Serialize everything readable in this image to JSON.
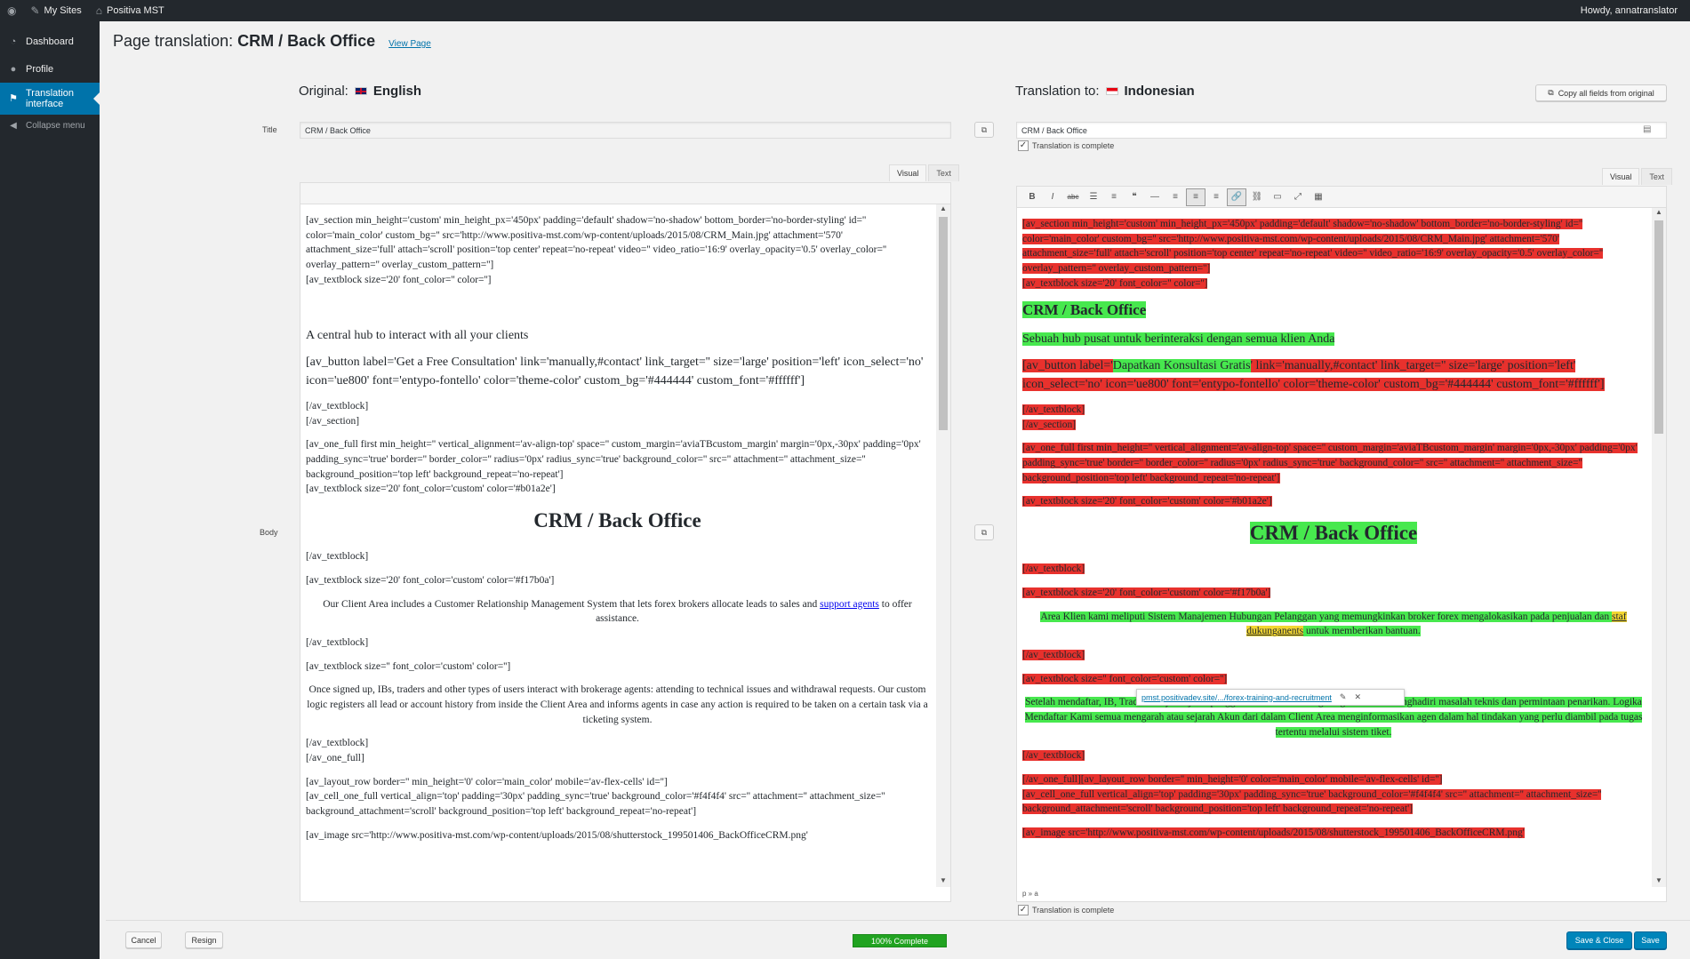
{
  "adminbar": {
    "mysites": "My Sites",
    "site": "Positiva MST",
    "howdy": "Howdy, annatranslator"
  },
  "sidebar": {
    "items": [
      {
        "label": "Dashboard",
        "icon": "dashboard-icon"
      },
      {
        "label": "Profile",
        "icon": "user-icon"
      },
      {
        "label": "Translation interface",
        "icon": "translation-icon"
      }
    ],
    "collapse": "Collapse menu"
  },
  "header": {
    "prefix": "Page translation:",
    "title": "CRM / Back Office",
    "view_link": "View Page"
  },
  "original": {
    "label": "Original:",
    "lang": "English"
  },
  "translation": {
    "label": "Translation to:",
    "lang": "Indonesian",
    "copy_all": "Copy all fields from original"
  },
  "fields": {
    "title_label": "Title",
    "body_label": "Body",
    "title_original": "CRM / Back Office",
    "title_translation": "CRM / Back Office",
    "complete_label": "Translation is complete"
  },
  "tabs": {
    "visual": "Visual",
    "text": "Text"
  },
  "original_body": {
    "p1": "[av_section min_height='custom' min_height_px='450px' padding='default' shadow='no-shadow' bottom_border='no-border-styling' id='' color='main_color' custom_bg='' src='http://www.positiva-mst.com/wp-content/uploads/2015/08/CRM_Main.jpg' attachment='570' attachment_size='full' attach='scroll' position='top center' repeat='no-repeat' video='' video_ratio='16:9' overlay_opacity='0.5' overlay_color='' overlay_pattern='' overlay_custom_pattern='']",
    "p1b": "[av_textblock size='20' font_color='' color='']",
    "h_ghost": "CRM / Back Office",
    "tagline": "A central hub to interact with all your clients",
    "button": "[av_button label='Get a Free Consultation' link='manually,#contact' link_target='' size='large' position='left' icon_select='no' icon='ue800' font='entypo-fontello' color='theme-color' custom_bg='#444444' custom_font='#ffffff']",
    "p2a": "[/av_textblock]",
    "p2b": "[/av_section]",
    "p3": "[av_one_full first min_height='' vertical_alignment='av-align-top' space='' custom_margin='aviaTBcustom_margin' margin='0px,-30px' padding='0px' padding_sync='true' border='' border_color='' radius='0px' radius_sync='true' background_color='' src='' attachment='' attachment_size='' background_position='top left' background_repeat='no-repeat']",
    "p3b": "[av_textblock size='20' font_color='custom' color='#b01a2e']",
    "h1": "CRM / Back Office",
    "p4": "[/av_textblock]",
    "p5": "[av_textblock size='20' font_color='custom' color='#f17b0a']",
    "p6a": "Our Client Area includes a Customer Relationship Management System that lets forex brokers allocate leads to sales and",
    "p6link": "support agents",
    "p6b": "to offer assistance.",
    "p7": "[/av_textblock]",
    "p8": "[av_textblock size='' font_color='custom' color='']",
    "p9": "Once signed up, IBs, traders and other types of users interact with brokerage agents: attending to technical issues and withdrawal requests. Our custom logic registers all lead or account history from inside the Client Area and informs agents in case any action is required to be taken on a certain task via a ticketing system.",
    "p10a": "[/av_textblock]",
    "p10b": "[/av_one_full]",
    "p11": "[av_layout_row border='' min_height='0' color='main_color' mobile='av-flex-cells' id='']",
    "p11b": "[av_cell_one_full vertical_align='top' padding='30px' padding_sync='true' background_color='#f4f4f4' src='' attachment='' attachment_size='' background_attachment='scroll' background_position='top left' background_repeat='no-repeat']",
    "p12": "[av_image src='http://www.positiva-mst.com/wp-content/uploads/2015/08/shutterstock_199501406_BackOfficeCRM.png'"
  },
  "translation_body": {
    "p1": "[av_section min_height='custom' min_height_px='450px' padding='default' shadow='no-shadow' bottom_border='no-border-styling' id='' color='main_color' custom_bg='' src='http://www.positiva-mst.com/wp-content/uploads/2015/08/CRM_Main.jpg' attachment='570' attachment_size='full' attach='scroll' position='top center' repeat='no-repeat' video='' video_ratio='16:9' overlay_opacity='0.5' overlay_color='' overlay_pattern='' overlay_custom_pattern='']",
    "p1b": "[av_textblock size='20' font_color='' color='']",
    "h2": "CRM / Back Office",
    "tagline": "Sebuah hub pusat untuk berinteraksi dengan semua klien Anda",
    "btn_a": "[av_button label='",
    "btn_label": "Dapatkan Konsultasi Gratis",
    "btn_b": "' link='manually,#contact' link_target='' size='large' position='left' icon_select='no' icon='ue800' font='entypo-fontello' color='theme-color' custom_bg='#444444' custom_font='#ffffff']",
    "p2a": "[/av_textblock]",
    "p2b": "[/av_section]",
    "p3": "[av_one_full first min_height='' vertical_alignment='av-align-top' space='' custom_margin='aviaTBcustom_margin' margin='0px,-30px' padding='0px' padding_sync='true' border='' border_color='' radius='0px' radius_sync='true' background_color='' src='' attachment='' attachment_size='' background_position='top left' background_repeat='no-repeat']",
    "p3b": "[av_textblock size='20' font_color='custom' color='#b01a2e']",
    "h1": "CRM / Back Office",
    "p4": "[/av_textblock]",
    "p5": "[av_textblock size='20' font_color='custom' color='#f17b0a']",
    "p6a": "Area Klien kami meliputi Sistem Manajemen Hubungan Pelanggan yang memungkinkan broker forex mengalokasikan pada penjualan dan",
    "p6link": "staf dukunganents",
    "p6b": "untuk memberikan bantuan.",
    "p7": "[/av_textblock]",
    "p8": "[av_textblock size='' font_color='custom' color='']",
    "p9": "Setelah mendaftar, IB, Trader dan jenis-jenis pengguna berinteraksi dengan agen broker: menghadiri masalah teknis dan permintaan penarikan. Logika Mendaftar Kami semua mengarah atau sejarah Akun dari dalam Client Area menginformasikan agen dalam hal tindakan yang perlu diambil pada tugas tertentu melalui sistem tiket.",
    "p10": "[/av_textblock]",
    "p11": "[/av_one_full][av_layout_row border='' min_height='0' color='main_color' mobile='av-flex-cells' id='']",
    "p11b": "[av_cell_one_full vertical_align='top' padding='30px' padding_sync='true' background_color='#f4f4f4' src='' attachment='' attachment_size='' background_attachment='scroll' background_position='top left' background_repeat='no-repeat']",
    "p12": "[av_image src='http://www.positiva-mst.com/wp-content/uploads/2015/08/shutterstock_199501406_BackOfficeCRM.png'",
    "path": "p » a"
  },
  "link_popup": {
    "url": "pmst.positivadev.site/.../forex-training-and-recruitment"
  },
  "footer": {
    "cancel": "Cancel",
    "resign": "Resign",
    "progress": "100% Complete",
    "save_close": "Save & Close",
    "save": "Save"
  },
  "colors": {
    "accent": "#0073aa",
    "untranslated": "#e8312d",
    "translated": "#47e84e",
    "progress": "#21a321"
  }
}
